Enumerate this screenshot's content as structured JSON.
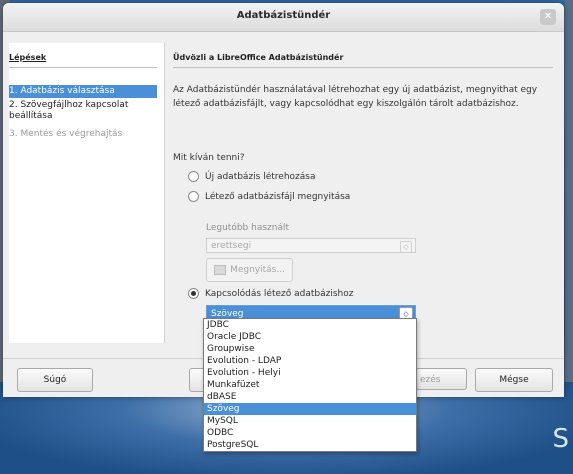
{
  "window": {
    "title": "Adatbázistündér"
  },
  "sidebar": {
    "title": "Lépések",
    "steps": [
      {
        "label": "1. Adatbázis választása",
        "state": "active"
      },
      {
        "label": "2. Szövegfájlhoz kapcsolat beállítása",
        "state": "normal"
      },
      {
        "label": "3. Mentés és végrehajtás",
        "state": "disabled"
      }
    ]
  },
  "main": {
    "welcome": "Üdvözli a LibreOffice Adatbázistündér",
    "intro": "Az Adatbázistündér használatával létrehozhat egy új adatbázist, megnyithat egy létező adatbázisfájlt, vagy kapcsolódhat egy kiszolgálón tárolt adatbázishoz.",
    "question": "Mit kíván tenni?",
    "options": [
      {
        "label": "Új adatbázis létrehozása",
        "checked": false
      },
      {
        "label": "Létező adatbázisfájl megnyitása",
        "checked": false
      },
      {
        "label": "Kapcsolódás létező adatbázishoz",
        "checked": true
      }
    ],
    "recent_label": "Legutóbb használt",
    "recent_value": "erettsegi",
    "open_button": "Megnyitás...",
    "connection_value": "Szöveg"
  },
  "dropdown": {
    "items": [
      "JDBC",
      "Oracle JDBC",
      "Groupwise",
      "Evolution - LDAP",
      "Evolution - Helyi",
      "Munkafüzet",
      "dBASE",
      "Szöveg",
      "MySQL",
      "ODBC",
      "PostgreSQL"
    ],
    "selected": "Szöveg"
  },
  "buttons": {
    "help": "Súgó",
    "finish_partial": "ezés",
    "cancel": "Mégse"
  },
  "desktop_glyph": "S"
}
